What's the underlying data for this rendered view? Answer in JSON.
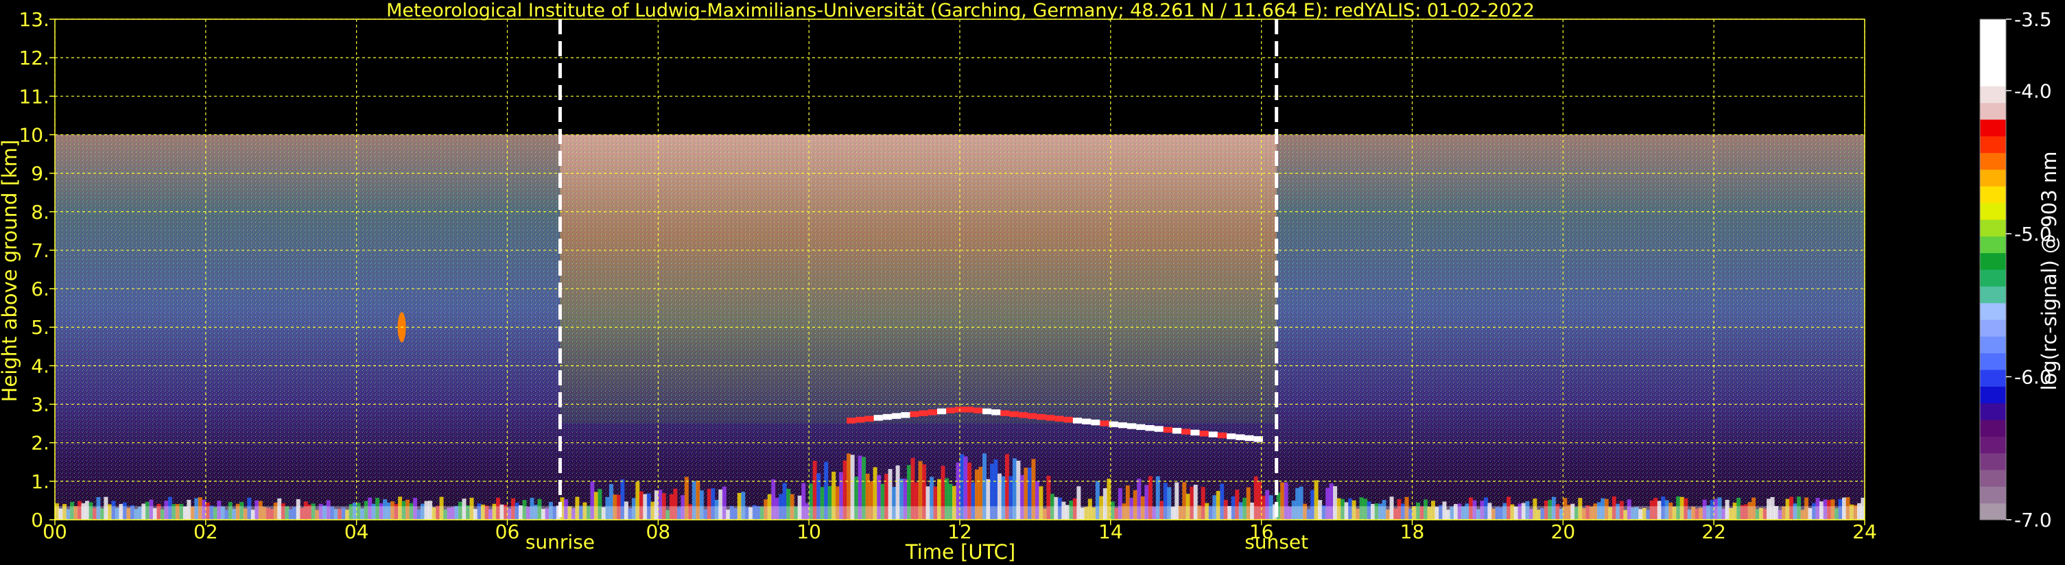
{
  "chart_data": {
    "type": "heatmap",
    "title": "Meteorological Institute of Ludwig-Maximilians-Universität (Garching, Germany; 48.261 N / 11.664 E):    redYALIS: 01-02-2022",
    "xlabel": "Time [UTC]",
    "ylabel": "Height above ground [km]",
    "xlim": [
      0,
      24
    ],
    "ylim": [
      0,
      13
    ],
    "x_ticks": [
      "00",
      "02",
      "04",
      "06",
      "08",
      "10",
      "12",
      "14",
      "16",
      "18",
      "20",
      "22",
      "24"
    ],
    "y_ticks": [
      "0.",
      "1.",
      "2.",
      "3.",
      "4.",
      "5.",
      "6.",
      "7.",
      "8.",
      "9.",
      "10.",
      "11.",
      "12.",
      "13."
    ],
    "grid": true,
    "markers": [
      {
        "label": "sunrise",
        "time": 6.7
      },
      {
        "label": "sunset",
        "time": 16.2
      }
    ],
    "data_max_height": 10,
    "colorbar": {
      "label": "log(rc-signal) @ 903 nm",
      "range": [
        -7.0,
        -3.5
      ],
      "tick_labels": [
        "-3.5",
        "-4.0",
        "-5.0",
        "-6.0",
        "-7.0"
      ],
      "tick_values": [
        -3.5,
        -4.0,
        -5.0,
        -6.0,
        -7.0
      ],
      "colors": [
        "#a898a8",
        "#98789a",
        "#8a5a8c",
        "#7a3a82",
        "#6a1a78",
        "#5a0a70",
        "#3a0a9a",
        "#1010d0",
        "#2a40f0",
        "#5070ff",
        "#7090ff",
        "#90a8ff",
        "#a0c0ff",
        "#50c0a0",
        "#20b060",
        "#10a030",
        "#60d040",
        "#a0e020",
        "#e0f000",
        "#ffe000",
        "#ffb000",
        "#ff7000",
        "#ff3000",
        "#f00000",
        "#e8c0c0",
        "#f0e0e0",
        "#ffffff",
        "#ffffff",
        "#ffffff",
        "#ffffff"
      ]
    },
    "features": [
      {
        "name": "boundary-layer",
        "desc": "multicolor signal below ~1 km"
      },
      {
        "name": "cloud-layer",
        "t_start": 10.5,
        "t_end": 16.0,
        "height_km": [
          2.0,
          3.0
        ]
      },
      {
        "name": "elevated-aerosol",
        "t": 4.6,
        "height_km": 5.0
      }
    ]
  }
}
